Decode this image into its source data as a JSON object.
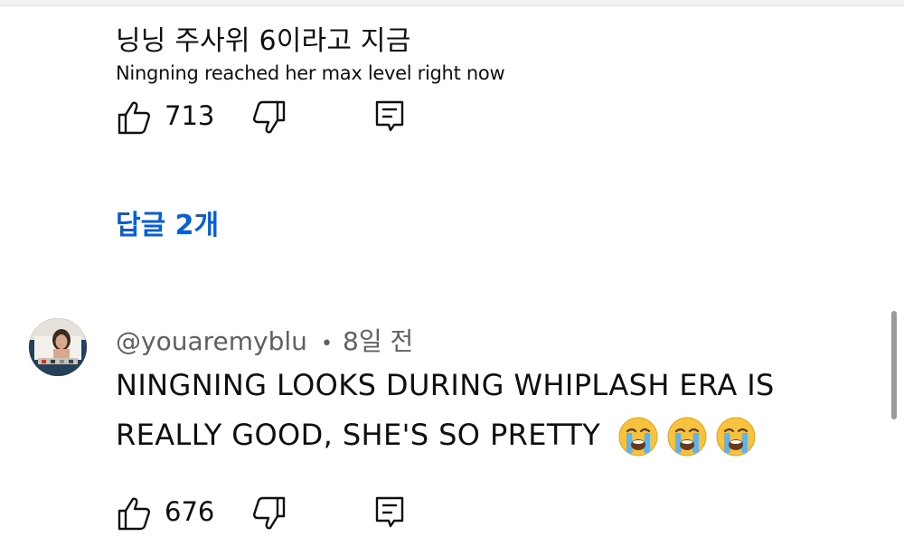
{
  "comment1": {
    "text": "닝닝 주사위 6이라고 지금",
    "translation": "Ningning reached her max level right now",
    "likes": "713",
    "replies_label": "답글 2개"
  },
  "comment2": {
    "author": "@youaremyblu",
    "separator": "•",
    "time": "8일 전",
    "line1": "NINGNING LOOKS DURING WHIPLASH ERA IS",
    "line2": "REALLY GOOD, SHE'S SO PRETTY",
    "emojis": [
      "loudly-crying-face",
      "loudly-crying-face",
      "loudly-crying-face"
    ],
    "likes": "676"
  },
  "colors": {
    "link": "#065fd4",
    "meta": "#606060",
    "text": "#0f0f0f"
  },
  "icons": [
    "like-icon",
    "dislike-icon",
    "reply-icon"
  ]
}
